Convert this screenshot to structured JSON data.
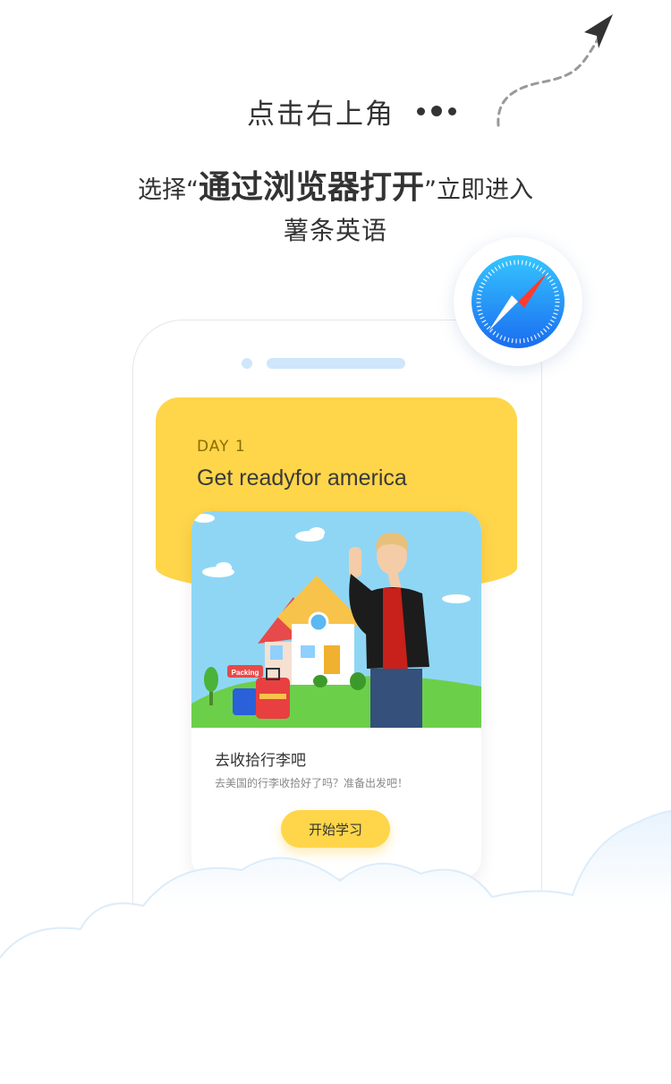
{
  "instruction": {
    "tap_corner": "点击右上角",
    "choose_prefix": "选择“",
    "choose_highlight": "通过浏览器打开",
    "choose_suffix": "”立即进入",
    "app_name": "薯条英语"
  },
  "icons": {
    "more": "more-dots-icon",
    "arrow": "curved-arrow-icon",
    "browser": "safari-compass-icon"
  },
  "lesson": {
    "day": "DAY 1",
    "title": "Get readyfor america",
    "sign": "Packing",
    "card_title": "去收拾行李吧",
    "card_subtitle": "去美国的行李收拾好了吗？准备出发吧！",
    "start_button": "开始学习"
  },
  "colors": {
    "banner": "#ffd54a",
    "button": "#ffd54a",
    "text": "#333333",
    "safari_blue": "#1e90ff",
    "phone_accent": "#cfe6fb"
  }
}
